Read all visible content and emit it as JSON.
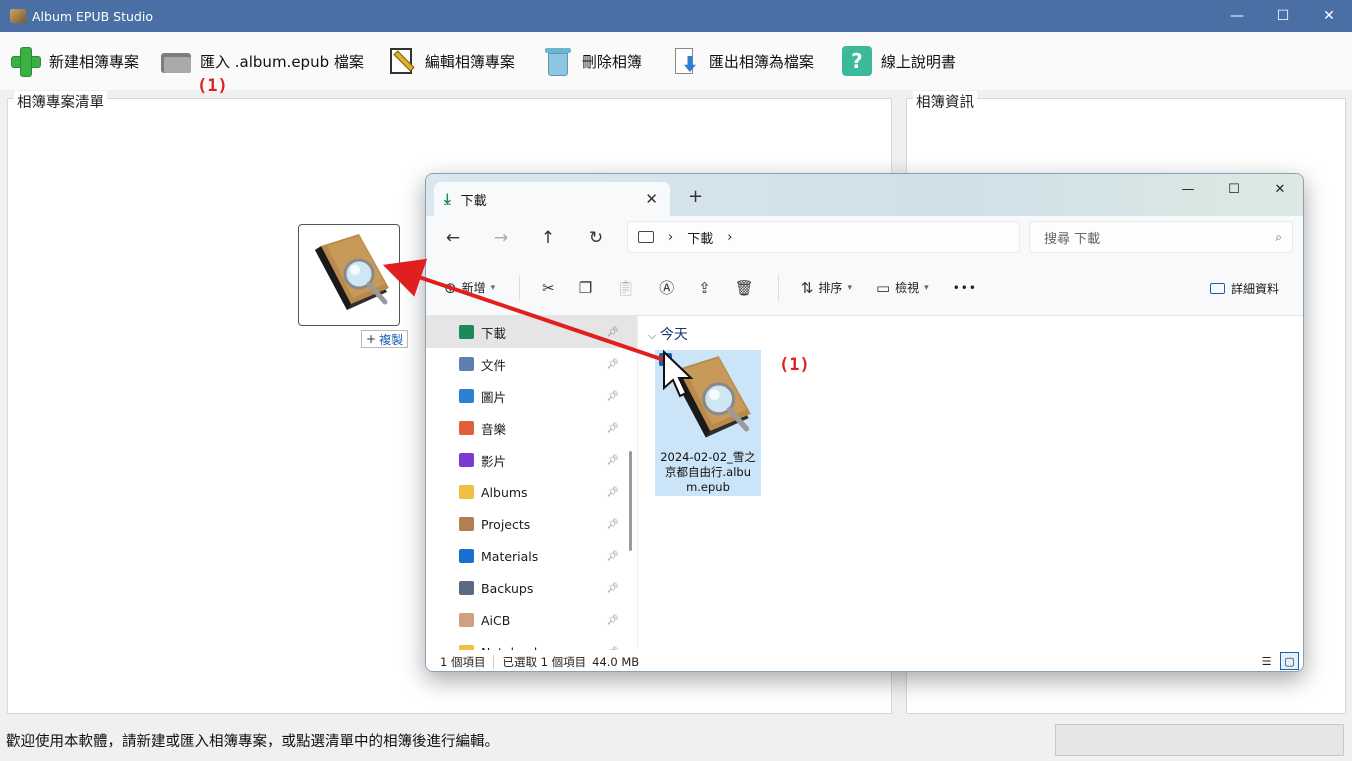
{
  "app": {
    "title": "Album EPUB Studio",
    "icon": "album-app-icon"
  },
  "window_controls": {
    "minimize": "—",
    "maximize": "☐",
    "close": "✕"
  },
  "toolbar": {
    "new": "新建相簿專案",
    "import": "匯入 .album.epub 檔案",
    "edit": "編輯相簿專案",
    "delete": "刪除相簿",
    "export": "匯出相簿為檔案",
    "help": "線上說明書",
    "help_glyph": "?"
  },
  "annotation": {
    "label": "(1)",
    "color": "#e02020"
  },
  "panels": {
    "left_title": "相簿專案清單",
    "right_title": "相簿資訊"
  },
  "drag": {
    "copy_label": "複製",
    "copy_glyph": "+"
  },
  "statusbar": {
    "message": "歡迎使用本軟體，請新建或匯入相簿專案，或點選清單中的相簿後進行編輯。"
  },
  "explorer": {
    "tab_title": "下載",
    "tab_close": "✕",
    "new_tab": "+",
    "window_controls": {
      "minimize": "—",
      "maximize": "☐",
      "close": "✕"
    },
    "nav": {
      "back": "←",
      "forward": "→",
      "up": "↑",
      "refresh": "↻"
    },
    "address": {
      "location": "下載",
      "sep": "›"
    },
    "search_placeholder": "搜尋 下載",
    "commands": {
      "new": "新增",
      "sort": "排序",
      "view": "檢視",
      "more": "•••",
      "details": "詳細資料"
    },
    "sidebar": [
      {
        "label": "下載",
        "icon": "download-icon",
        "color": "#1a8a5a",
        "pinned": true,
        "selected": true
      },
      {
        "label": "文件",
        "icon": "document-icon",
        "color": "#5a7fb0",
        "pinned": true
      },
      {
        "label": "圖片",
        "icon": "pictures-icon",
        "color": "#2d7fd3",
        "pinned": true
      },
      {
        "label": "音樂",
        "icon": "music-icon",
        "color": "#e0603a",
        "pinned": true
      },
      {
        "label": "影片",
        "icon": "video-icon",
        "color": "#7a3ad3",
        "pinned": true
      },
      {
        "label": "Albums",
        "icon": "folder-icon",
        "color": "#f0c040",
        "pinned": true
      },
      {
        "label": "Projects",
        "icon": "box-folder-icon",
        "color": "#b08050",
        "pinned": true
      },
      {
        "label": "Materials",
        "icon": "accessibility-icon",
        "color": "#1a6fd3",
        "pinned": true
      },
      {
        "label": "Backups",
        "icon": "disk-icon",
        "color": "#5a6a80",
        "pinned": true
      },
      {
        "label": "AiCB",
        "icon": "avatar-icon",
        "color": "#d0a080",
        "pinned": true
      },
      {
        "label": "Notebooks",
        "icon": "folder-icon",
        "color": "#f0c040",
        "pinned": true
      }
    ],
    "group_header": "今天",
    "file": {
      "name": "2024-02-02_雪之京都自由行.album.epub"
    },
    "status": {
      "count": "1 個項目",
      "selected": "已選取 1 個項目",
      "size": "44.0 MB"
    }
  }
}
